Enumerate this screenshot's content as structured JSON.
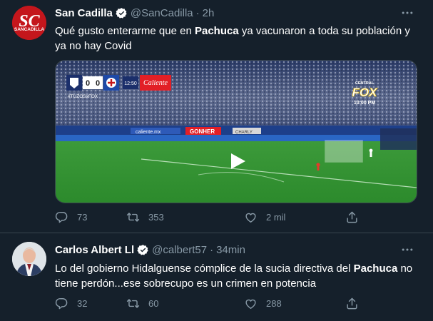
{
  "tweets": [
    {
      "name": "San Cadilla",
      "handle": "@SanCadilla",
      "time": "2h",
      "avatar_text": "SANCADILLA",
      "text_before": "Qué gusto enterarme que en ",
      "text_bold": "Pachuca",
      "text_after": " ya vacunaron a toda su población y ya no hay Covid",
      "media": {
        "score_home": "0",
        "score_away": "0",
        "clock": "12:50",
        "hashtag": "#TUZOSxFOX",
        "sponsor": "Caliente",
        "broadcaster_top": "CENTRAL",
        "broadcaster": "FOX",
        "broadcast_time": "10:00 PM",
        "board_1": "caliente.mx",
        "board_2": "GONHER",
        "board_3": "CHARLY"
      },
      "replies": "73",
      "retweets": "353",
      "likes": "2 mil"
    },
    {
      "name": "Carlos Albert Ll",
      "handle": "@calbert57",
      "time": "34min",
      "text_before": "Lo del gobierno Hidalguense cómplice de la sucia directiva del ",
      "text_bold": "Pachuca",
      "text_after": " no tiene perdón...ese sobrecupo es un crimen en potencia",
      "replies": "32",
      "retweets": "60",
      "likes": "288"
    }
  ],
  "colors": {
    "background": "#15202b",
    "divider": "#38444d",
    "secondary_text": "#8899a6",
    "verified": "#1da1f2"
  },
  "icons": [
    "verified-badge-icon",
    "more-options-icon",
    "reply-icon",
    "retweet-icon",
    "like-icon",
    "share-icon",
    "play-icon"
  ]
}
